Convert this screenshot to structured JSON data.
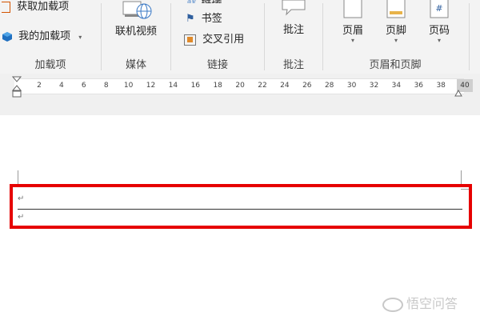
{
  "ribbon": {
    "addins": {
      "get_addins": "获取加载项",
      "my_addins": "我的加载项",
      "group_label": "加载项"
    },
    "media": {
      "online_video": "联机视频",
      "group_label": "媒体"
    },
    "links": {
      "link_partial": "链接",
      "bookmark": "书签",
      "cross_reference": "交叉引用",
      "group_label": "链接"
    },
    "comments": {
      "comment": "批注",
      "group_label": "批注"
    },
    "header_footer": {
      "header": "页眉",
      "footer": "页脚",
      "page_number": "页码",
      "group_label": "页眉和页脚"
    }
  },
  "ruler": {
    "ticks": [
      "2",
      "4",
      "6",
      "8",
      "10",
      "12",
      "14",
      "16",
      "18",
      "20",
      "22",
      "24",
      "26",
      "28",
      "30",
      "32",
      "34",
      "36",
      "38"
    ],
    "end": "40"
  },
  "document": {
    "paragraph_mark": "↵"
  },
  "watermark": "悟空问答",
  "colors": {
    "highlight": "#e60000",
    "ribbon_bg": "#f3f3f3"
  }
}
